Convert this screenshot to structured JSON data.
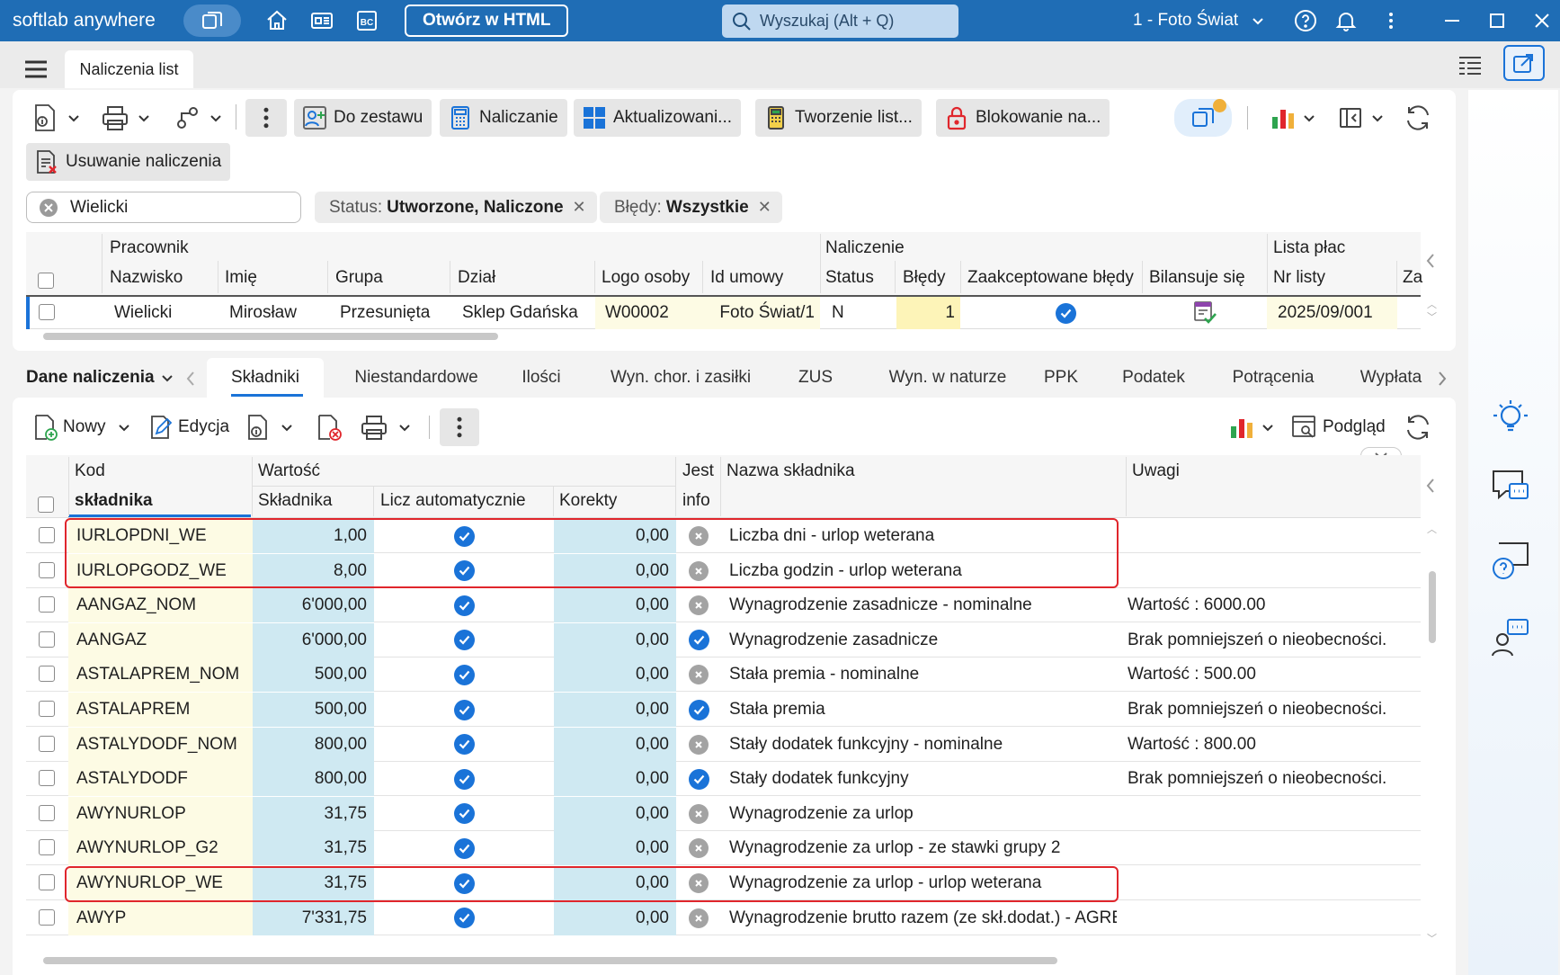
{
  "titlebar": {
    "brand": "softlab anywhere",
    "open_html": "Otwórz w HTML",
    "search_placeholder": "Wyszukaj (Alt + Q)",
    "company": "1 - Foto Świat",
    "bc_label": "BC"
  },
  "tab": {
    "title": "Naliczenia list"
  },
  "toolbar": {
    "do_zestawu": "Do zestawu",
    "naliczanie": "Naliczanie",
    "aktualizowanie": "Aktualizowani...",
    "tworzenie": "Tworzenie list...",
    "blokowanie": "Blokowanie na...",
    "usuwanie": "Usuwanie naliczenia"
  },
  "filters": {
    "search_value": "Wielicki",
    "status_label": "Status:",
    "status_value": "Utworzone, Naliczone",
    "errors_label": "Błędy:",
    "errors_value": "Wszystkie"
  },
  "top_grid": {
    "group_pracownik": "Pracownik",
    "group_naliczenie": "Naliczenie",
    "group_lista": "Lista płac",
    "columns": [
      "Nazwisko",
      "Imię",
      "Grupa",
      "Dział",
      "Logo osoby",
      "Id umowy",
      "Status",
      "Błędy",
      "Zaakceptowane błędy",
      "Bilansuje się",
      "Nr listy",
      "Za"
    ],
    "row": {
      "nazwisko": "Wielicki",
      "imie": "Mirosław",
      "grupa": "Przesunięta",
      "dzial": "Sklep Gdańska",
      "logo": "W00002",
      "id_umowy": "Foto Świat/1",
      "status": "N",
      "bledy": "1",
      "nr_listy": "2025/09/001"
    }
  },
  "section": {
    "title": "Dane naliczenia",
    "tabs": [
      "Składniki",
      "Niestandardowe",
      "Ilości",
      "Wyn. chor. i zasiłki",
      "ZUS",
      "Wyn. w naturze",
      "PPK",
      "Podatek",
      "Potrącenia",
      "Wypłata"
    ],
    "active_tab": "Składniki"
  },
  "sub_toolbar": {
    "nowy": "Nowy",
    "edycja": "Edycja",
    "podglad": "Podgląd"
  },
  "components_grid": {
    "headers": {
      "kod_1": "Kod",
      "kod_2": "składnika",
      "wartosc": "Wartość",
      "skladnika": "Składnika",
      "licz": "Licz automatycznie",
      "korekty": "Korekty",
      "jest_1": "Jest",
      "jest_2": "info",
      "nazwa": "Nazwa składnika",
      "uwagi": "Uwagi"
    },
    "rows": [
      {
        "kod": "IURLOPDNI_WE",
        "wartosc": "1,00",
        "licz": true,
        "korekty": "0,00",
        "info": false,
        "nazwa": "Liczba dni -  urlop weterana",
        "uwagi": ""
      },
      {
        "kod": "IURLOPGODZ_WE",
        "wartosc": "8,00",
        "licz": true,
        "korekty": "0,00",
        "info": false,
        "nazwa": "Liczba godzin -  urlop weterana",
        "uwagi": ""
      },
      {
        "kod": "AANGAZ_NOM",
        "wartosc": "6'000,00",
        "licz": true,
        "korekty": "0,00",
        "info": false,
        "nazwa": "Wynagrodzenie zasadnicze - nominalne",
        "uwagi": "Wartość : 6000.00"
      },
      {
        "kod": "AANGAZ",
        "wartosc": "6'000,00",
        "licz": true,
        "korekty": "0,00",
        "info": true,
        "nazwa": "Wynagrodzenie zasadnicze",
        "uwagi": "Brak pomniejszeń o nieobecności."
      },
      {
        "kod": "ASTALAPREM_NOM",
        "wartosc": "500,00",
        "licz": true,
        "korekty": "0,00",
        "info": false,
        "nazwa": "Stała premia - nominalne",
        "uwagi": "Wartość : 500.00"
      },
      {
        "kod": "ASTALAPREM",
        "wartosc": "500,00",
        "licz": true,
        "korekty": "0,00",
        "info": true,
        "nazwa": "Stała premia",
        "uwagi": "Brak pomniejszeń o nieobecności."
      },
      {
        "kod": "ASTALYDODF_NOM",
        "wartosc": "800,00",
        "licz": true,
        "korekty": "0,00",
        "info": false,
        "nazwa": "Stały dodatek funkcyjny - nominalne",
        "uwagi": "Wartość : 800.00"
      },
      {
        "kod": "ASTALYDODF",
        "wartosc": "800,00",
        "licz": true,
        "korekty": "0,00",
        "info": true,
        "nazwa": "Stały dodatek funkcyjny",
        "uwagi": "Brak pomniejszeń o nieobecności."
      },
      {
        "kod": "AWYNURLOP",
        "wartosc": "31,75",
        "licz": true,
        "korekty": "0,00",
        "info": false,
        "nazwa": "Wynagrodzenie za urlop",
        "uwagi": ""
      },
      {
        "kod": "AWYNURLOP_G2",
        "wartosc": "31,75",
        "licz": true,
        "korekty": "0,00",
        "info": false,
        "nazwa": "Wynagrodzenie za urlop - ze stawki grupy 2",
        "uwagi": ""
      },
      {
        "kod": "AWYNURLOP_WE",
        "wartosc": "31,75",
        "licz": true,
        "korekty": "0,00",
        "info": false,
        "nazwa": "Wynagrodzenie za urlop - urlop weterana",
        "uwagi": ""
      },
      {
        "kod": "AWYP",
        "wartosc": "7'331,75",
        "licz": true,
        "korekty": "0,00",
        "info": false,
        "nazwa": "Wynagrodzenie brutto razem (ze skł.dodat.) - AGRE",
        "uwagi": ""
      }
    ]
  },
  "colors": {
    "titlebar": "#1f6db5",
    "accent": "#1a73d8",
    "highlight": "#e0262c",
    "kod_bg": "#fdfbe4",
    "value_bg": "#cfe9f2"
  }
}
